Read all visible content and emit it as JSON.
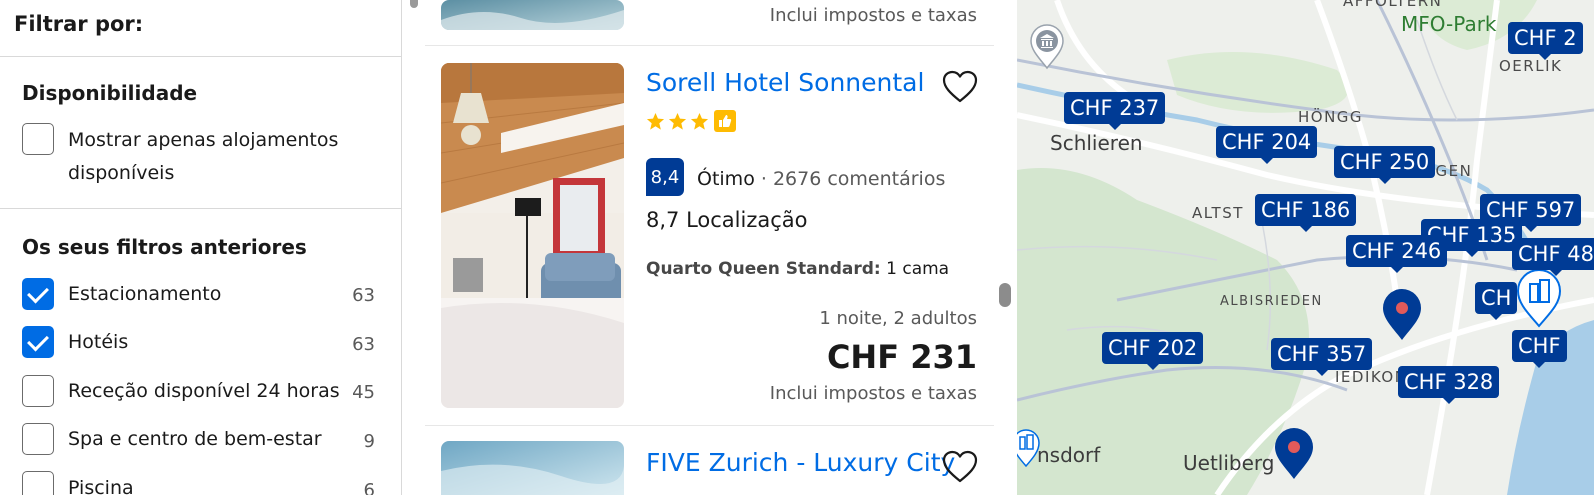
{
  "filters": {
    "title": "Filtrar por:",
    "availability": {
      "heading": "Disponibilidade",
      "option_line1": "Mostrar apenas alojamentos",
      "option_line2": "disponíveis"
    },
    "previous": {
      "heading": "Os seus filtros anteriores",
      "items": [
        {
          "label": "Estacionamento",
          "count": "63",
          "checked": true
        },
        {
          "label": "Hotéis",
          "count": "63",
          "checked": true
        },
        {
          "label": "Receção disponível 24 horas",
          "count": "45",
          "checked": false
        },
        {
          "label": "Spa e centro de bem-estar",
          "count": "9",
          "checked": false
        },
        {
          "label": "Piscina",
          "count": "6",
          "checked": false
        }
      ]
    }
  },
  "results": {
    "prev_card_tax": "Inclui impostos e taxas",
    "card": {
      "name": "Sorell Hotel Sonnental",
      "stars": 3,
      "score": "8,4",
      "score_word": "Ótimo",
      "reviews": "· 2676 comentários",
      "location_score": "8,7 Localização",
      "room_type": "Quarto Queen Standard:",
      "room_beds": "1 cama",
      "stay": "1 noite, 2 adultos",
      "price": "CHF 231",
      "tax_note": "Inclui impostos e taxas"
    },
    "next_card": {
      "name": "FIVE Zurich - Luxury City"
    }
  },
  "map": {
    "labels": {
      "mfo_park": "MFO-Park",
      "oerlikon": "OERLIK",
      "affoltern": "AFFOLTERN",
      "hongg": "HÖNGG",
      "schlieren": "Schlieren",
      "wipkingen": "PKINGEN",
      "altstetten": "ALTST",
      "albisrieden": "ALBISRIEDEN",
      "wiedikon": "IEDIKON",
      "birmensdorf": "nsdorf",
      "uetliberg": "Uetliberg"
    },
    "price_tags": {
      "p1": "CHF 237",
      "p2": "CHF 204",
      "p3": "CHF 250",
      "p4": "CHF 186",
      "p5": "CHF 597",
      "p6": "CHF 135",
      "p7": "CHF 246",
      "p8": "CHF 48",
      "p9": "CH",
      "p10": "CHF 202",
      "p11": "CHF 357",
      "p12": "CHF 328",
      "p13": "CHF",
      "p14": "CHF 2"
    },
    "colors": {
      "tag": "#003b95",
      "pin": "#003b95",
      "pin_dot": "#e15a5a"
    }
  }
}
